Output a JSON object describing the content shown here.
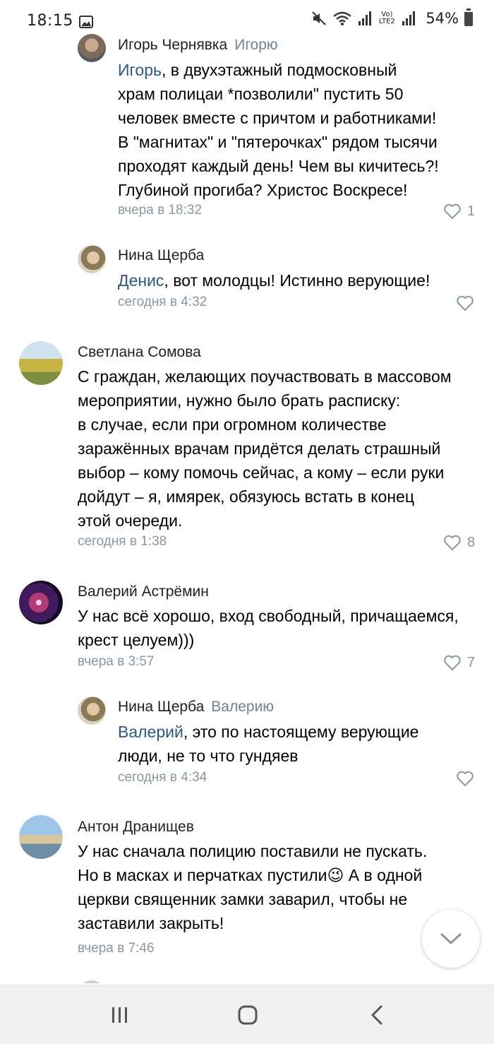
{
  "status_bar": {
    "time": "18:15",
    "battery": "54%",
    "network": "Vo) LTE2",
    "icons": [
      "gallery-icon",
      "mute-icon",
      "wifi-icon",
      "signal-icon",
      "battery-icon"
    ]
  },
  "comments": [
    {
      "author": "Игорь Чернявка",
      "reply_to": "Игорю",
      "mention": "Игорь",
      "text_lines": [
        ", в двухэтажный подмосковный",
        "храм полицаи *позволили\" пустить 50",
        "человек вместе с причтом и работниками!",
        "В \"магнитах\" и \"пятерочках\" рядом тысячи",
        "проходят каждый день! Чем вы кичитесь?!",
        "Глубиной прогиба? Христос Воскресе!"
      ],
      "time": "вчера в 18:32",
      "likes": "1"
    },
    {
      "author": "Нина Щерба",
      "reply_to": "",
      "mention": "Денис",
      "text_lines": [
        ", вот молодцы! Истинно верующие!"
      ],
      "time": "сегодня в 4:32",
      "likes": ""
    },
    {
      "author": "Светлана Сомова",
      "reply_to": "",
      "mention": "",
      "text_lines": [
        "С граждан, желающих поучаствовать в массовом",
        "мероприятии, нужно было брать расписку:",
        "в случае, если при огромном количестве",
        "заражённых врачам придётся делать страшный",
        "выбор – кому помочь сейчас, а кому – если руки",
        "дойдут – я, имярек, обязуюсь встать в конец",
        "этой очереди."
      ],
      "time": "сегодня в 1:38",
      "likes": "8"
    },
    {
      "author": "Валерий Астрёмин",
      "reply_to": "",
      "mention": "",
      "text_lines": [
        "У нас всё хорошо, вход свободный, причащаемся,",
        "крест целуем)))"
      ],
      "time": "вчера в 3:57",
      "likes": "7"
    },
    {
      "author": "Нина Щерба",
      "reply_to": "Валерию",
      "mention": "Валерий",
      "text_lines": [
        ", это по настоящему верующие",
        "люди, не то что гундяев"
      ],
      "time": "сегодня в 4:34",
      "likes": ""
    },
    {
      "author": "Антон Дранищев",
      "reply_to": "",
      "mention": "",
      "text_lines": [
        "У нас сначала полицию поставили не пускать.",
        "Но в масках и перчатках пустили",
        "церкви священник замки заварил, чтобы не",
        "заставили закрыть!"
      ],
      "inline_after_emoji": " А в одной",
      "emoji": "😉",
      "time": "вчера в 7:46",
      "likes": ""
    }
  ],
  "colors": {
    "mention": "#2a5885",
    "meta": "#8a96a3",
    "nav_bg": "#f0f0f0"
  }
}
